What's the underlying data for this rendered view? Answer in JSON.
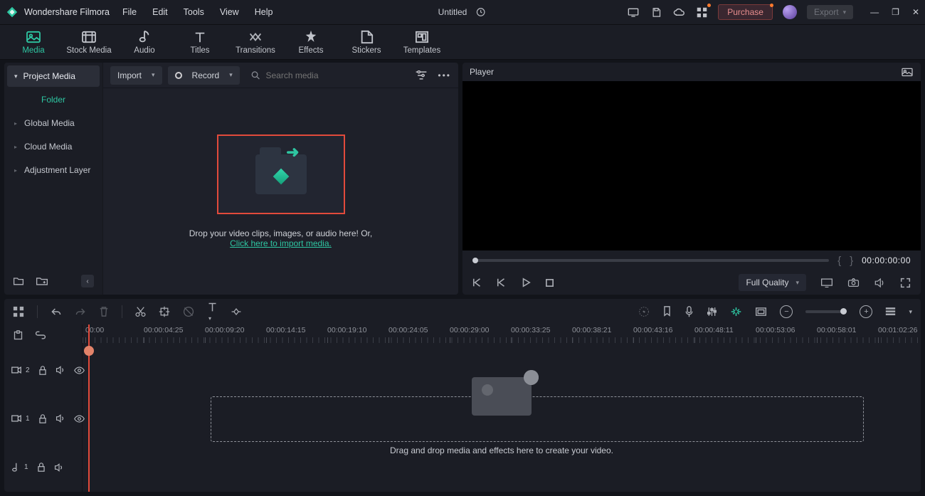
{
  "titlebar": {
    "app_name": "Wondershare Filmora",
    "menus": [
      "File",
      "Edit",
      "Tools",
      "View",
      "Help"
    ],
    "doc_title": "Untitled",
    "purchase_label": "Purchase",
    "export_label": "Export"
  },
  "tabs": [
    {
      "label": "Media",
      "active": true
    },
    {
      "label": "Stock Media"
    },
    {
      "label": "Audio"
    },
    {
      "label": "Titles"
    },
    {
      "label": "Transitions"
    },
    {
      "label": "Effects"
    },
    {
      "label": "Stickers"
    },
    {
      "label": "Templates"
    }
  ],
  "sidebar": {
    "header": "Project Media",
    "folder_label": "Folder",
    "items": [
      "Global Media",
      "Cloud Media",
      "Adjustment Layer"
    ]
  },
  "mediabar": {
    "import_label": "Import",
    "record_label": "Record",
    "search_placeholder": "Search media"
  },
  "dropzone": {
    "line1": "Drop your video clips, images, or audio here! Or,",
    "link": "Click here to import media."
  },
  "player": {
    "title": "Player",
    "timecode": "00:00:00:00",
    "quality_label": "Full Quality"
  },
  "timeline": {
    "ruler": [
      "00:00",
      "00:00:04:25",
      "00:00:09:20",
      "00:00:14:15",
      "00:00:19:10",
      "00:00:24:05",
      "00:00:29:00",
      "00:00:33:25",
      "00:00:38:21",
      "00:00:43:16",
      "00:00:48:11",
      "00:00:53:06",
      "00:00:58:01",
      "00:01:02:26"
    ],
    "tracks": [
      {
        "icon": "video",
        "num": "2"
      },
      {
        "icon": "video",
        "num": "1"
      },
      {
        "icon": "audio",
        "num": "1"
      }
    ],
    "hint": "Drag and drop media and effects here to create your video."
  }
}
